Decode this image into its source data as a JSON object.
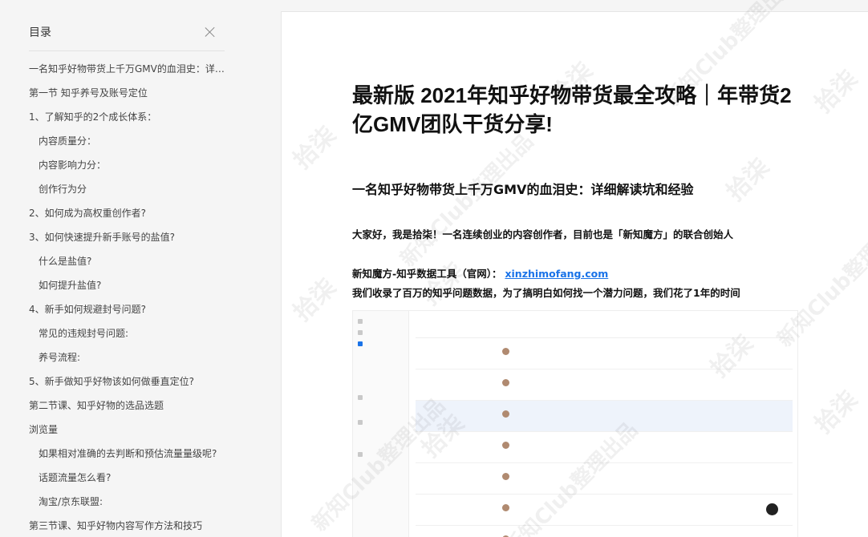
{
  "toc": {
    "title": "目录",
    "items": [
      {
        "label": "一名知乎好物带货上千万GMV的血泪史：详细解读坑和经验",
        "level": 1
      },
      {
        "label": "第一节 知乎养号及账号定位",
        "level": 1
      },
      {
        "label": "1、了解知乎的2个成长体系：",
        "level": 1
      },
      {
        "label": "内容质量分：",
        "level": 2
      },
      {
        "label": "内容影响力分：",
        "level": 2
      },
      {
        "label": "创作行为分",
        "level": 2
      },
      {
        "label": "2、如何成为高权重创作者?",
        "level": 1
      },
      {
        "label": "3、如何快速提升新手账号的盐值?",
        "level": 1
      },
      {
        "label": "什么是盐值?",
        "level": 2
      },
      {
        "label": "如何提升盐值?",
        "level": 2
      },
      {
        "label": "4、新手如何规避封号问题?",
        "level": 1
      },
      {
        "label": "常见的违规封号问题:",
        "level": 2
      },
      {
        "label": "养号流程:",
        "level": 2
      },
      {
        "label": "5、新手做知乎好物该如何做垂直定位?",
        "level": 1
      },
      {
        "label": "第二节课、知乎好物的选品选题",
        "level": 1
      },
      {
        "label": "浏览量",
        "level": 1
      },
      {
        "label": "如果相对准确的去判断和预估流量量级呢?",
        "level": 2
      },
      {
        "label": "话题流量怎么看?",
        "level": 2
      },
      {
        "label": "淘宝/京东联盟:",
        "level": 2
      },
      {
        "label": "第三节课、知乎好物内容写作方法和技巧",
        "level": 1
      }
    ]
  },
  "article": {
    "title": "最新版 2021年知乎好物带货最全攻略｜年带货2亿GMV团队干货分享!",
    "h2": "一名知乎好物带货上千万GMV的血泪史：详细解读坑和经验",
    "intro": "大家好，我是拾柒！一名连续创业的内容创作者，目前也是「新知魔方」的联合创始人",
    "tool_label": "新知魔方-知乎数据工具（官网）：",
    "tool_link": "xinzhimofang.com",
    "para": "我们收录了百万的知乎问题数据，为了搞明白如何找一个潜力问题，我们花了1年的时间"
  },
  "watermark": "拾柒",
  "watermark2": "新知Club整理出品"
}
